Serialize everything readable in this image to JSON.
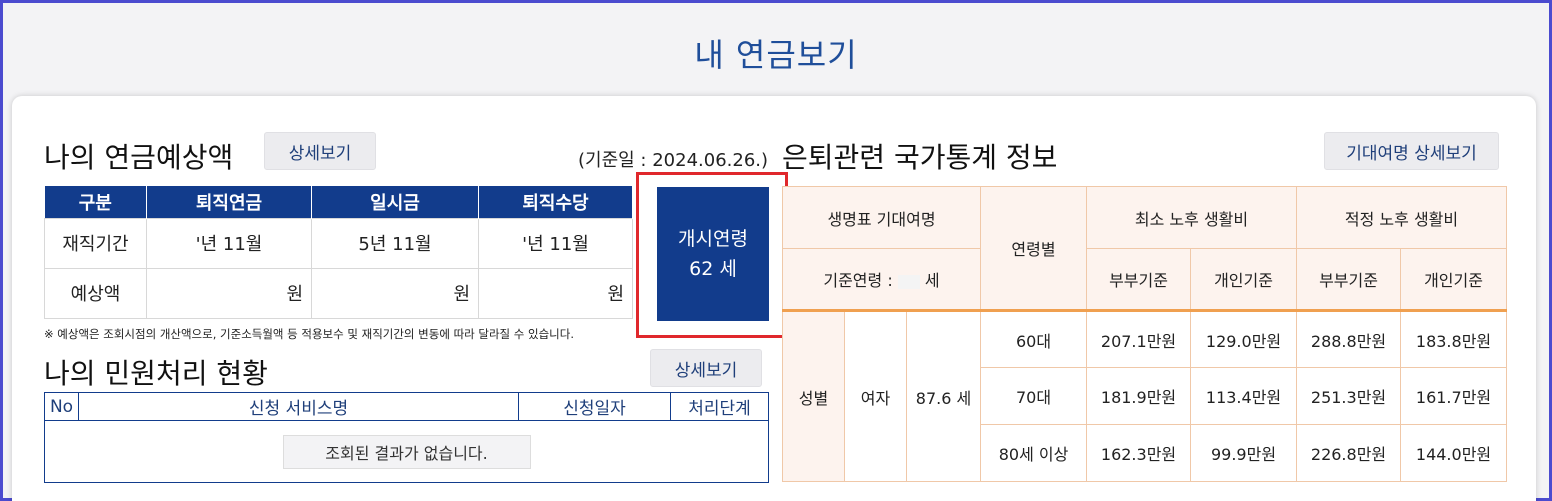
{
  "page": {
    "title": "내 연금보기"
  },
  "pension": {
    "title": "나의 연금예상액",
    "detail_button": "상세보기",
    "base_date": "(기준일 : 2024.06.26.)",
    "headers": [
      "구분",
      "퇴직연금",
      "일시금",
      "퇴직수당"
    ],
    "service_label": "재직기간",
    "service_values": [
      "'년 11월",
      "5년 11월",
      "'년 11월"
    ],
    "amount_label": "예상액",
    "amount_unit": "원",
    "start_age_label": "개시연령",
    "start_age_value": "62 세",
    "note": "※ 예상액은 조회시점의 개산액으로, 기준소득월액 등 적용보수 및 재직기간의 변동에 따라 달라질 수 있습니다."
  },
  "civil": {
    "title": "나의 민원처리 현황",
    "detail_button": "상세보기",
    "headers": [
      "No",
      "신청 서비스명",
      "신청일자",
      "처리단계"
    ],
    "empty_message": "조회된 결과가 없습니다."
  },
  "stats": {
    "title": "은퇴관련 국가통계 정보",
    "detail_button": "기대여명 상세보기",
    "life_table_header": "생명표 기대여명",
    "base_age_label": "기준연령 :",
    "base_age_unit": "세",
    "age_group_header": "연령별",
    "min_cost_header": "최소 노후 생활비",
    "proper_cost_header": "적정 노후 생활비",
    "couple_label": "부부기준",
    "individual_label": "개인기준",
    "gender_label": "성별",
    "gender_value": "여자",
    "life_expectancy": "87.6 세",
    "rows": [
      {
        "age": "60대",
        "min_couple": "207.1만원",
        "min_indiv": "129.0만원",
        "proper_couple": "288.8만원",
        "proper_indiv": "183.8만원"
      },
      {
        "age": "70대",
        "min_couple": "181.9만원",
        "min_indiv": "113.4만원",
        "proper_couple": "251.3만원",
        "proper_indiv": "161.7만원"
      },
      {
        "age": "80세 이상",
        "min_couple": "162.3만원",
        "min_indiv": "99.9만원",
        "proper_couple": "226.8만원",
        "proper_indiv": "144.0만원"
      }
    ]
  },
  "colors": {
    "navy": "#123c8c",
    "frame": "#4b4bcf",
    "highlight": "#e0282c",
    "stats_border": "#f0a050"
  }
}
